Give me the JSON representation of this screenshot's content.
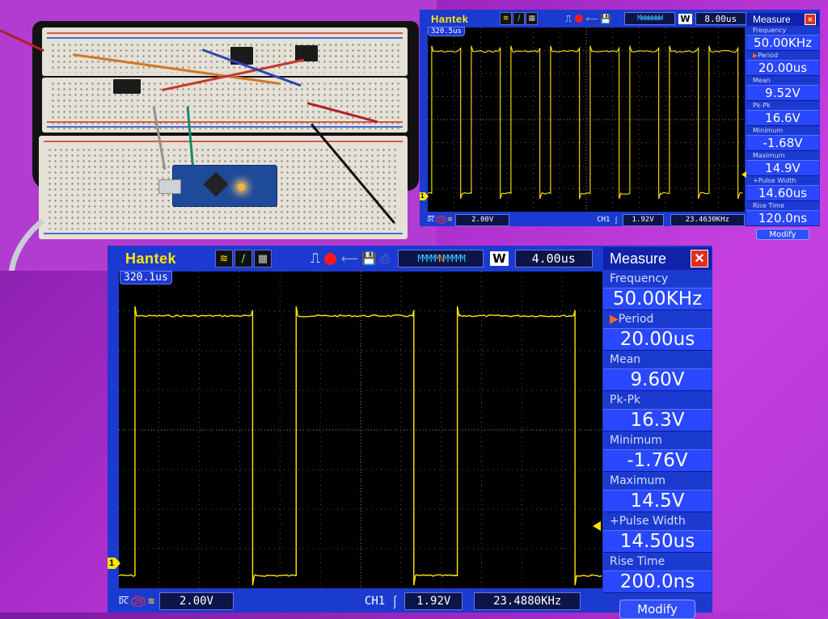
{
  "small_scope": {
    "brand": "Hantek",
    "timebase": "8.00us",
    "window_mode": "W",
    "trigger_pos": "320.5us",
    "ch_marker": "1",
    "coupling": "DC",
    "bw_limit": "20",
    "volts_div": "2.00V",
    "trigger_ch": "CH1",
    "trigger_level": "1.92V",
    "counter": "23.4630KHz",
    "measure": {
      "title": "Measure",
      "items": [
        {
          "label": "Frequency",
          "value": "50.00KHz"
        },
        {
          "label": "Period",
          "value": "20.00us",
          "selected": true
        },
        {
          "label": "Mean",
          "value": "9.52V"
        },
        {
          "label": "Pk-Pk",
          "value": "16.6V"
        },
        {
          "label": "Minimum",
          "value": "-1.68V"
        },
        {
          "label": "Maximum",
          "value": "14.9V"
        },
        {
          "label": "+Pulse Width",
          "value": "14.60us"
        },
        {
          "label": "Rise Time",
          "value": "120.0ns"
        }
      ],
      "modify_label": "Modify"
    },
    "waveform": {
      "periods_visible": 8,
      "duty": 0.73,
      "high_level": 0.13,
      "low_level": 0.9
    }
  },
  "large_scope": {
    "brand": "Hantek",
    "timebase": "4.00us",
    "window_mode": "W",
    "trigger_pos": "320.1us",
    "ch_marker": "1",
    "coupling": "DC",
    "bw_limit": "20",
    "volts_div": "2.00V",
    "trigger_ch": "CH1",
    "trigger_level": "1.92V",
    "counter": "23.4880KHz",
    "measure": {
      "title": "Measure",
      "items": [
        {
          "label": "Frequency",
          "value": "50.00KHz"
        },
        {
          "label": "Period",
          "value": "20.00us",
          "selected": true
        },
        {
          "label": "Mean",
          "value": "9.60V"
        },
        {
          "label": "Pk-Pk",
          "value": "16.3V"
        },
        {
          "label": "Minimum",
          "value": "-1.76V"
        },
        {
          "label": "Maximum",
          "value": "14.5V"
        },
        {
          "label": "+Pulse Width",
          "value": "14.50us"
        },
        {
          "label": "Rise Time",
          "value": "200.0ns"
        }
      ],
      "modify_label": "Modify"
    },
    "waveform": {
      "periods_visible": 3,
      "duty": 0.73,
      "high_level": 0.14,
      "low_level": 0.96
    }
  },
  "colors": {
    "trace": "#ffe600",
    "panel_blue": "#1b3ad0",
    "close_red": "#e52d1f"
  }
}
